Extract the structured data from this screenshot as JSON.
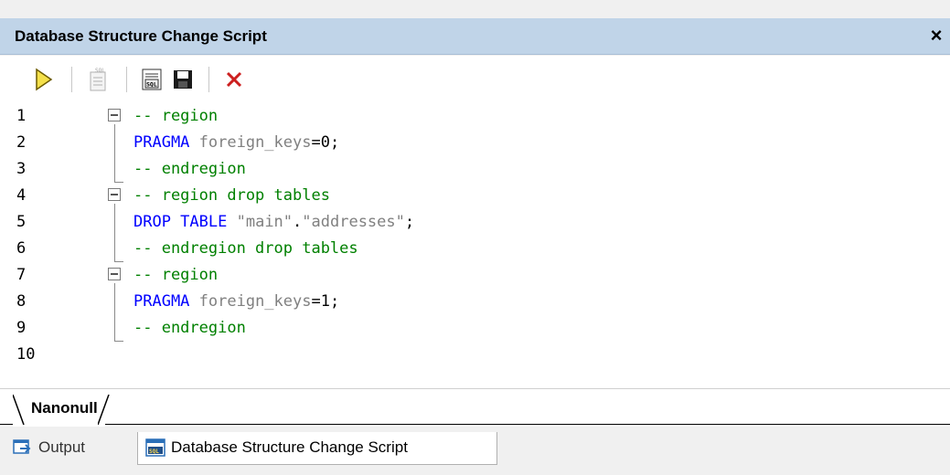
{
  "panel": {
    "title": "Database Structure Change Script",
    "close_symbol": "×"
  },
  "toolbar": {
    "buttons": [
      {
        "name": "execute-icon",
        "tooltip": ""
      },
      {
        "name": "sql-script-icon"
      },
      {
        "name": "open-sql-editor-icon"
      },
      {
        "name": "save-icon"
      },
      {
        "name": "close-red-x-icon"
      }
    ]
  },
  "editor": {
    "lines": [
      {
        "n": "1",
        "tokens": [
          {
            "t": "-- region",
            "c": "comment"
          }
        ]
      },
      {
        "n": "2",
        "tokens": [
          {
            "t": "PRAGMA",
            "c": "kw"
          },
          {
            "t": " foreign_keys",
            "c": "id"
          },
          {
            "t": "=",
            "c": "punct"
          },
          {
            "t": "0",
            "c": "num"
          },
          {
            "t": ";",
            "c": "punct"
          }
        ]
      },
      {
        "n": "3",
        "tokens": [
          {
            "t": "-- endregion",
            "c": "comment"
          }
        ]
      },
      {
        "n": "4",
        "tokens": [
          {
            "t": "-- region drop tables",
            "c": "comment"
          }
        ]
      },
      {
        "n": "5",
        "tokens": [
          {
            "t": "DROP TABLE",
            "c": "kw"
          },
          {
            "t": " ",
            "c": "punct"
          },
          {
            "t": "\"main\"",
            "c": "str"
          },
          {
            "t": ".",
            "c": "punct"
          },
          {
            "t": "\"addresses\"",
            "c": "str"
          },
          {
            "t": ";",
            "c": "punct"
          }
        ]
      },
      {
        "n": "6",
        "tokens": [
          {
            "t": "-- endregion drop tables",
            "c": "comment"
          }
        ]
      },
      {
        "n": "7",
        "tokens": [
          {
            "t": "-- region",
            "c": "comment"
          }
        ]
      },
      {
        "n": "8",
        "tokens": [
          {
            "t": "PRAGMA",
            "c": "kw"
          },
          {
            "t": " foreign_keys",
            "c": "id"
          },
          {
            "t": "=",
            "c": "punct"
          },
          {
            "t": "1",
            "c": "num"
          },
          {
            "t": ";",
            "c": "punct"
          }
        ]
      },
      {
        "n": "9",
        "tokens": [
          {
            "t": "-- endregion",
            "c": "comment"
          }
        ]
      },
      {
        "n": "10",
        "tokens": []
      }
    ]
  },
  "connection_tab": {
    "label": "Nanonull"
  },
  "bottom_tabs": [
    {
      "label": "Output",
      "icon": "output-icon",
      "active": false
    },
    {
      "label": "Database Structure Change Script",
      "icon": "sql-script-tab-icon",
      "active": true
    }
  ],
  "colors": {
    "title_bg": "#c0d4e8",
    "comment": "#008000",
    "keyword": "#0000ff",
    "identifier": "#808080"
  }
}
